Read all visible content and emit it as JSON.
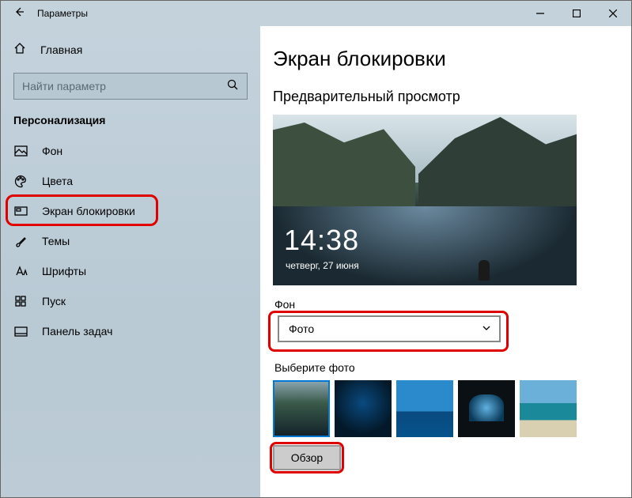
{
  "window": {
    "title": "Параметры"
  },
  "sidebar": {
    "home": "Главная",
    "search_placeholder": "Найти параметр",
    "section": "Персонализация",
    "items": [
      {
        "label": "Фон"
      },
      {
        "label": "Цвета"
      },
      {
        "label": "Экран блокировки"
      },
      {
        "label": "Темы"
      },
      {
        "label": "Шрифты"
      },
      {
        "label": "Пуск"
      },
      {
        "label": "Панель задач"
      }
    ]
  },
  "main": {
    "heading": "Экран блокировки",
    "preview_label": "Предварительный просмотр",
    "preview": {
      "time": "14:38",
      "date": "четверг, 27 июня"
    },
    "background_label": "Фон",
    "background_value": "Фото",
    "choose_label": "Выберите фото",
    "browse_label": "Обзор"
  }
}
